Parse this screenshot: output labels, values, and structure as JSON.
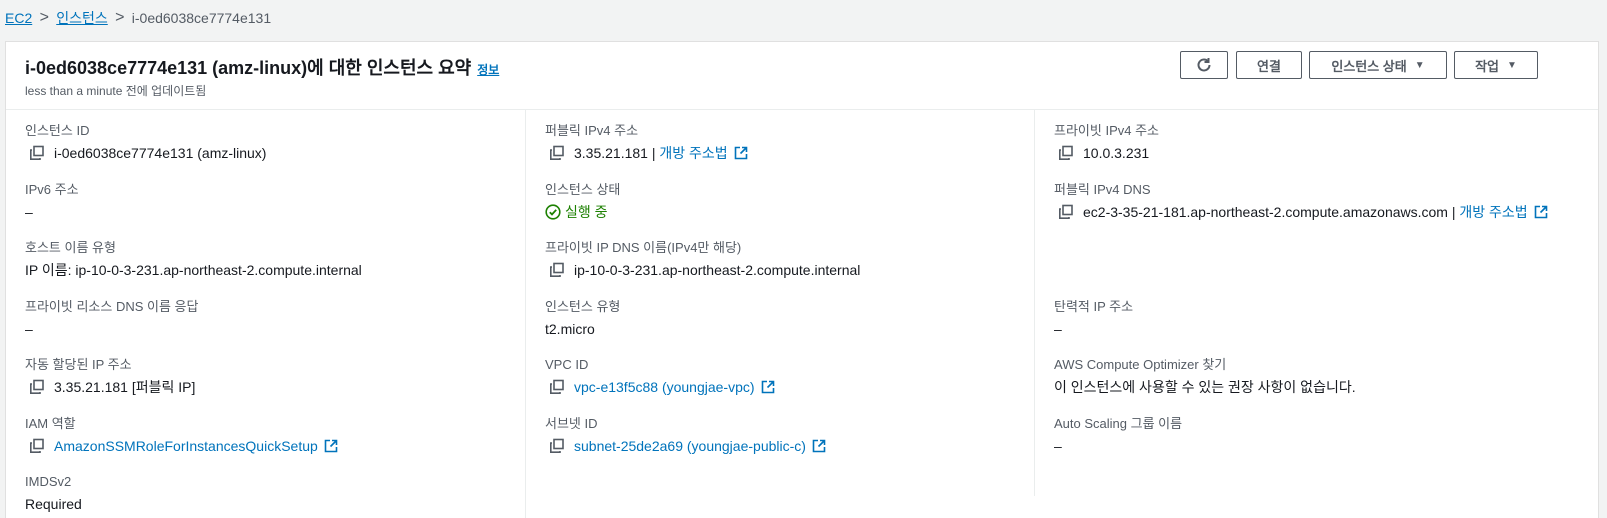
{
  "breadcrumb": {
    "items": [
      "EC2",
      "인스턴스"
    ],
    "current": "i-0ed6038ce7774e131",
    "separator": ">"
  },
  "header": {
    "title": "i-0ed6038ce7774e131 (amz-linux)에 대한 인스턴스 요약",
    "info_label": "정보",
    "updated": "less than a minute 전에 업데이트됨",
    "buttons": {
      "connect": "연결",
      "instance_state": "인스턴스 상태",
      "actions": "작업"
    }
  },
  "fields": {
    "instance_id": {
      "label": "인스턴스 ID",
      "value": "i-0ed6038ce7774e131 (amz-linux)"
    },
    "ipv6": {
      "label": "IPv6 주소",
      "value": "–"
    },
    "hostname_type": {
      "label": "호스트 이름 유형",
      "value": "IP 이름: ip-10-0-3-231.ap-northeast-2.compute.internal"
    },
    "private_resource_dns": {
      "label": "프라이빗 리소스 DNS 이름 응답",
      "value": "–"
    },
    "auto_ip": {
      "label": "자동 할당된 IP 주소",
      "value": "3.35.21.181 [퍼블릭 IP]"
    },
    "iam_role": {
      "label": "IAM 역할",
      "value": "AmazonSSMRoleForInstancesQuickSetup"
    },
    "imdsv2": {
      "label": "IMDSv2",
      "value": "Required"
    },
    "public_ipv4": {
      "label": "퍼블릭 IPv4 주소",
      "value": "3.35.21.181 |",
      "link": "개방 주소법"
    },
    "instance_state": {
      "label": "인스턴스 상태",
      "value": "실행 중"
    },
    "private_ip_dns": {
      "label": "프라이빗 IP DNS 이름(IPv4만 해당)",
      "value": "ip-10-0-3-231.ap-northeast-2.compute.internal"
    },
    "instance_type": {
      "label": "인스턴스 유형",
      "value": "t2.micro"
    },
    "vpc_id": {
      "label": "VPC ID",
      "value": "vpc-e13f5c88 (youngjae-vpc)"
    },
    "subnet_id": {
      "label": "서브넷 ID",
      "value": "subnet-25de2a69 (youngjae-public-c)"
    },
    "private_ipv4": {
      "label": "프라이빗 IPv4 주소",
      "value": "10.0.3.231"
    },
    "public_dns": {
      "label": "퍼블릭 IPv4 DNS",
      "value": "ec2-3-35-21-181.ap-northeast-2.compute.amazonaws.com |",
      "link": "개방 주소법"
    },
    "elastic_ip": {
      "label": "탄력적 IP 주소",
      "value": "–"
    },
    "compute_optimizer": {
      "label": "AWS Compute Optimizer 찾기",
      "value": "이 인스턴스에 사용할 수 있는 권장 사항이 없습니다."
    },
    "asg_name": {
      "label": "Auto Scaling 그룹 이름",
      "value": "–"
    }
  },
  "icons": {
    "copy": "copy-icon",
    "external": "external-link-icon",
    "refresh": "refresh-icon",
    "status_ok": "check-circle-icon",
    "dropdown": "caret-down-icon"
  },
  "colors": {
    "link": "#0073bb",
    "success": "#1d8102",
    "text": "#16191f",
    "muted": "#545b64"
  }
}
